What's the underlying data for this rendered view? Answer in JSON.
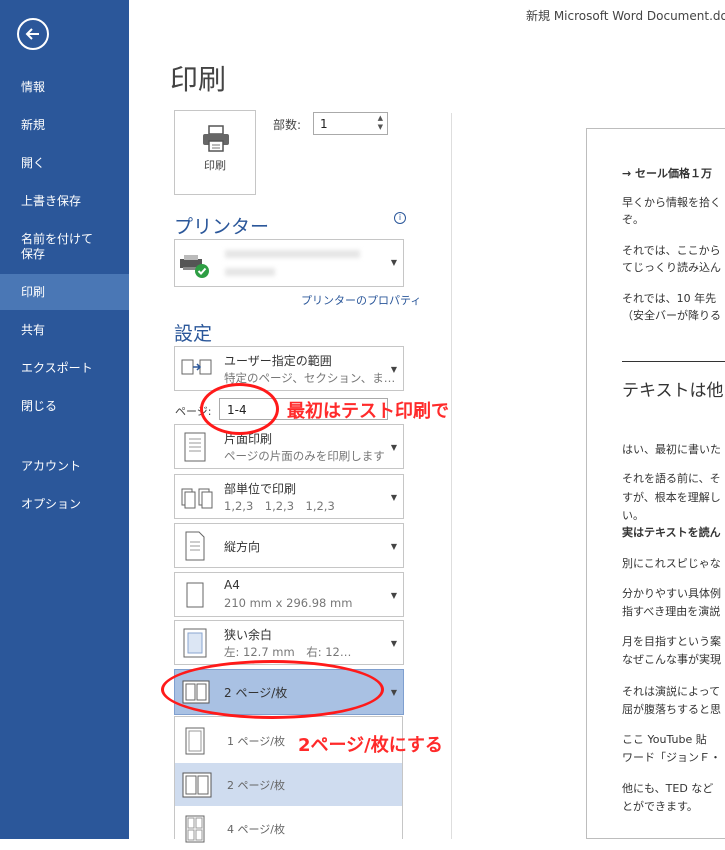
{
  "nav": {
    "items": [
      {
        "label": "情報"
      },
      {
        "label": "新規"
      },
      {
        "label": "開く"
      },
      {
        "label": "上書き保存"
      },
      {
        "label": "名前を付けて\n保存"
      },
      {
        "label": "印刷",
        "active": true
      },
      {
        "label": "共有"
      },
      {
        "label": "エクスポート"
      },
      {
        "label": "閉じる"
      },
      {
        "label": "アカウント"
      },
      {
        "label": "オプション"
      }
    ]
  },
  "title_bar": {
    "document": "新規 Microsoft Word Document.do"
  },
  "page_title": "印刷",
  "print_button": {
    "label": "印刷"
  },
  "copies": {
    "label": "部数:",
    "value": "1"
  },
  "printer": {
    "heading": "プリンター",
    "properties_link": "プリンターのプロパティ"
  },
  "settings": {
    "heading": "設定",
    "range": {
      "title": "ユーザー指定の範囲",
      "subtitle": "特定のページ、セクション、ま…"
    },
    "pages": {
      "label": "ページ:",
      "value": "1-4"
    },
    "sides": {
      "title": "片面印刷",
      "subtitle": "ページの片面のみを印刷します"
    },
    "collate": {
      "title": "部単位で印刷",
      "subtitle": "1,2,3　1,2,3　1,2,3"
    },
    "orientation": {
      "title": "縦方向"
    },
    "paper": {
      "title": "A4",
      "subtitle": "210 mm x 296.98 mm"
    },
    "margins": {
      "title": "狭い余白",
      "subtitle": "左: 12.7 mm　右: 12…"
    },
    "pages_per_sheet": {
      "title": "2 ページ/枚"
    },
    "dropdown": [
      {
        "label": "1 ページ/枚"
      },
      {
        "label": "2 ページ/枚",
        "selected": true
      },
      {
        "label": "4 ページ/枚"
      }
    ]
  },
  "annotations": {
    "test_print": "最初はテスト印刷で",
    "two_per_sheet": "2ページ/枚にする",
    "color": "#ff2a2a"
  },
  "preview": {
    "lines": [
      "→ セール価格１万",
      "早くから情報を拾く",
      "ぞ。",
      "それでは、ここから",
      "てじっくり読み込ん",
      "それでは、10 年先",
      "（安全バーが降りる",
      "テキストは他",
      "はい、最初に書いた",
      "それを語る前に、そ",
      "すが、根本を理解し",
      "い。",
      "実はテキストを読ん",
      "別にこれスピじゃな",
      "分かりやすい具体例",
      "指すべき理由を演説",
      "月を目指すという案",
      "なぜこんな事が実現",
      "それは演説によって",
      "屈が腹落ちすると思",
      "ここ YouTube 貼",
      "ワード「ジョンＦ・",
      "他にも、TED など",
      "とができます。"
    ]
  },
  "colors": {
    "accent": "#2b579a",
    "nav_active": "#4a77b5",
    "selected": "#a9c1e3",
    "annotation": "#ff2a2a"
  }
}
